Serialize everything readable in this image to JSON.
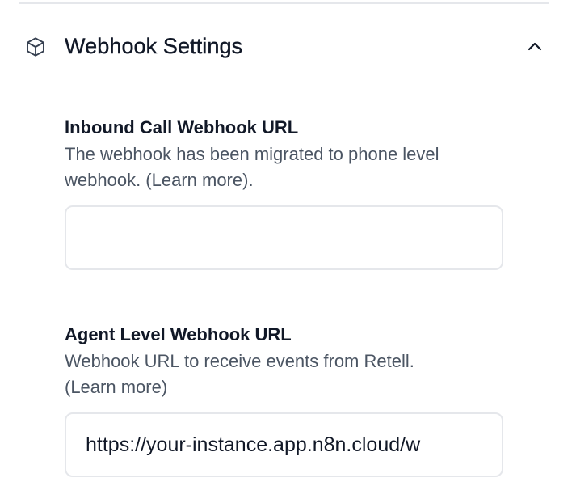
{
  "section": {
    "title": "Webhook Settings",
    "icon": "cube-icon",
    "toggle_icon": "chevron-up-icon",
    "expanded": true
  },
  "fields": {
    "inbound": {
      "label": "Inbound Call Webhook URL",
      "description_line1": "The webhook has been migrated to phone level",
      "description_line2": "webhook. (Learn more).",
      "value": "",
      "placeholder": ""
    },
    "agent": {
      "label": "Agent Level Webhook URL",
      "description_line1": "Webhook URL to receive events from Retell.",
      "description_line2": "(Learn more)",
      "value": "https://your-instance.app.n8n.cloud/w",
      "placeholder": ""
    }
  },
  "colors": {
    "border": "#e5e7eb",
    "text": "#111827",
    "muted": "#4b5563"
  }
}
